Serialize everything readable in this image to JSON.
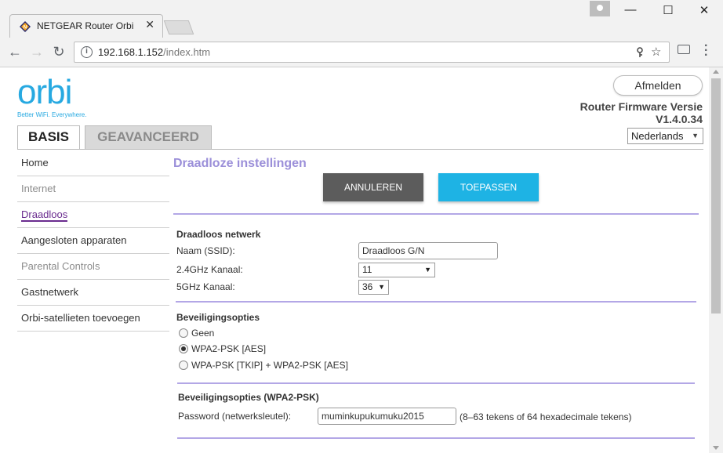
{
  "browser": {
    "tab_title": "NETGEAR Router Orbi",
    "tab_close": "✕",
    "url_host": "192.168.1.152",
    "url_path": "/index.htm",
    "window_controls": [
      "—",
      "☐",
      "✕"
    ]
  },
  "header": {
    "logo_text": "orbi",
    "logo_tagline": "Better WiFi. Everywhere.",
    "logout_label": "Afmelden",
    "firmware_label": "Router Firmware Versie",
    "firmware_version": "V1.4.0.34",
    "language": "Nederlands"
  },
  "main_tabs": [
    {
      "label": "BASIS",
      "active": true
    },
    {
      "label": "GEAVANCEERD",
      "active": false
    }
  ],
  "sidebar": {
    "items": [
      {
        "label": "Home",
        "state": "normal"
      },
      {
        "label": "Internet",
        "state": "muted"
      },
      {
        "label": "Draadloos",
        "state": "active"
      },
      {
        "label": "Aangesloten apparaten",
        "state": "normal"
      },
      {
        "label": "Parental Controls",
        "state": "muted"
      },
      {
        "label": "Gastnetwerk",
        "state": "normal"
      },
      {
        "label": "Orbi-satellieten toevoegen",
        "state": "normal"
      }
    ]
  },
  "content": {
    "title": "Draadloze instellingen",
    "cancel_label": "ANNULEREN",
    "apply_label": "TOEPASSEN",
    "wireless": {
      "heading": "Draadloos netwerk",
      "ssid_label": "Naam (SSID):",
      "ssid_value": "Draadloos G/N",
      "channel24_label": "2.4GHz Kanaal:",
      "channel24_value": "11",
      "channel5_label": "5GHz Kanaal:",
      "channel5_value": "36"
    },
    "security": {
      "heading": "Beveiligingsopties",
      "options": [
        {
          "label": "Geen",
          "checked": false
        },
        {
          "label": "WPA2-PSK [AES]",
          "checked": true
        },
        {
          "label": "WPA-PSK [TKIP] + WPA2-PSK [AES]",
          "checked": false
        }
      ]
    },
    "wpa2": {
      "heading": "Beveiligingsopties (WPA2-PSK)",
      "password_label": "Password (netwerksleutel):",
      "password_value": "muminkupukumuku2015",
      "password_hint": "(8–63 tekens of 64 hexadecimale tekens)"
    }
  },
  "colors": {
    "accent_purple": "#9b8fd9",
    "active_nav": "#6a2c8f",
    "apply_button": "#1eb3e4",
    "cancel_button": "#5c5c5c",
    "logo_blue": "#27a9e1"
  }
}
